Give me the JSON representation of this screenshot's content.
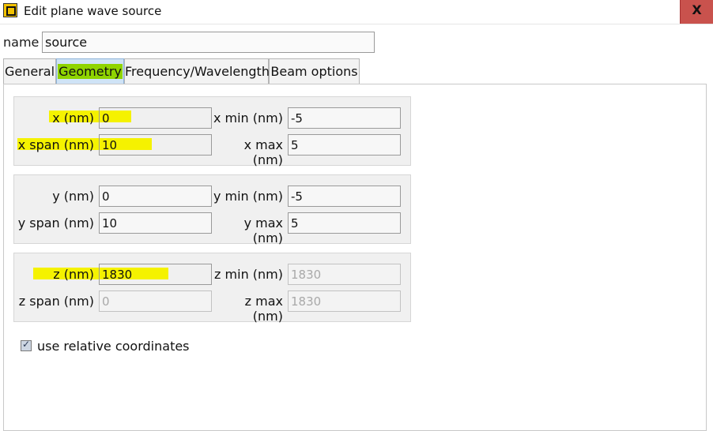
{
  "window": {
    "title": "Edit plane wave source",
    "close_glyph": "X"
  },
  "name_field": {
    "label": "name",
    "value": "source"
  },
  "tabs": [
    {
      "label": "General",
      "active": false
    },
    {
      "label": "Geometry",
      "active": true
    },
    {
      "label": "Frequency/Wavelength",
      "active": false
    },
    {
      "label": "Beam options",
      "active": false
    }
  ],
  "groups": {
    "x": {
      "center_label": "x (nm)",
      "center_value": "0",
      "span_label": "x span (nm)",
      "span_value": "10",
      "min_label": "x min (nm)",
      "min_value": "-5",
      "max_label": "x max (nm)",
      "max_value": "5"
    },
    "y": {
      "center_label": "y (nm)",
      "center_value": "0",
      "span_label": "y span (nm)",
      "span_value": "10",
      "min_label": "y min (nm)",
      "min_value": "-5",
      "max_label": "y max (nm)",
      "max_value": "5"
    },
    "z": {
      "center_label": "z (nm)",
      "center_value": "1830",
      "span_label": "z span (nm)",
      "span_value": "0",
      "min_label": "z min (nm)",
      "min_value": "1830",
      "max_label": "z max (nm)",
      "max_value": "1830"
    }
  },
  "relative_coordinates": {
    "label": "use relative coordinates",
    "checked": true
  },
  "colors": {
    "highlight_yellow": "#f5f200",
    "highlight_green": "#8fd400",
    "close_red": "#c9524d"
  }
}
